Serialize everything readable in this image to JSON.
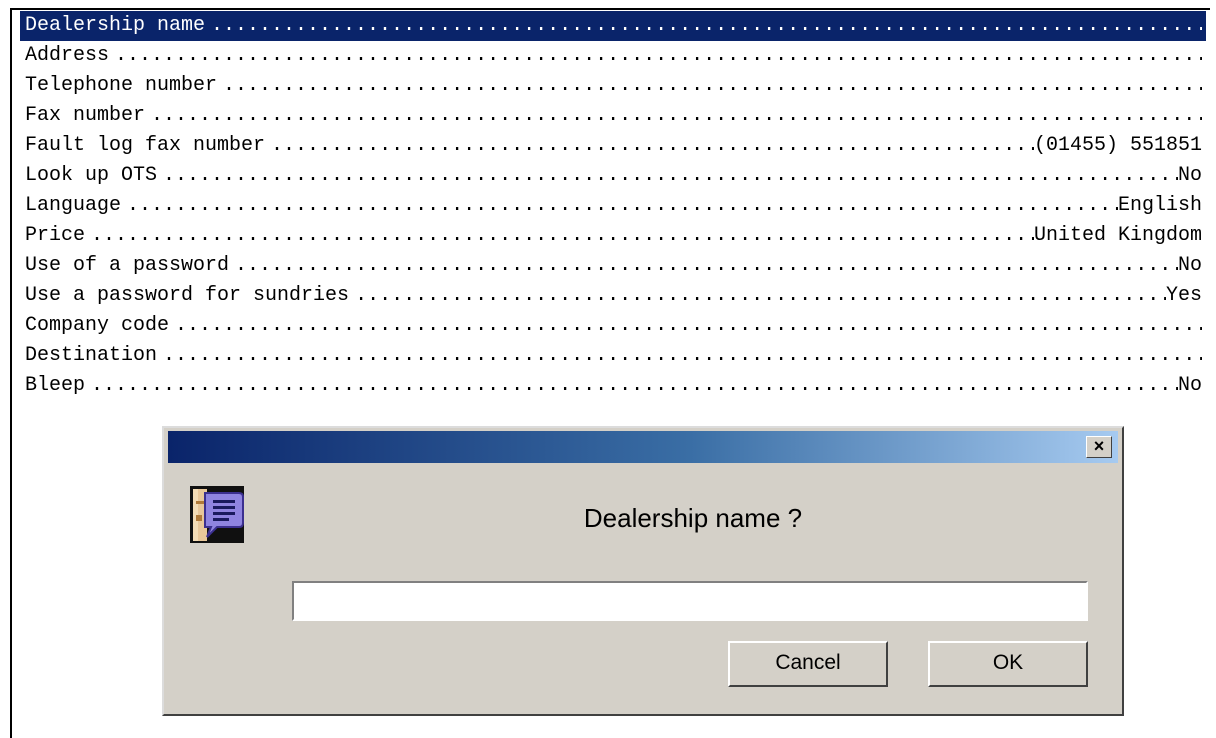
{
  "settings": {
    "rows": [
      {
        "label": "Dealership name",
        "value": "",
        "selected": true
      },
      {
        "label": "Address",
        "value": ""
      },
      {
        "label": "Telephone number",
        "value": ""
      },
      {
        "label": "Fax number",
        "value": ""
      },
      {
        "label": "Fault log fax number",
        "value": "(01455) 551851"
      },
      {
        "label": "Look up OTS",
        "value": "No"
      },
      {
        "label": "Language",
        "value": "English"
      },
      {
        "label": "Price",
        "value": "United Kingdom"
      },
      {
        "label": "Use of a password",
        "value": "No"
      },
      {
        "label": "Use a password for sundries",
        "value": "Yes"
      },
      {
        "label": "Company code",
        "value": ""
      },
      {
        "label": "Destination",
        "value": ""
      },
      {
        "label": "Bleep",
        "value": "No"
      }
    ]
  },
  "dialog": {
    "close_label": "×",
    "icon": "speech-bubble-icon",
    "prompt": "Dealership name ?",
    "input_value": "",
    "cancel_label": "Cancel",
    "ok_label": "OK"
  },
  "colors": {
    "selection": "#0a246a",
    "dialog_bg": "#d4d0c8",
    "title_start": "#0a246a",
    "title_end": "#a6caf0"
  }
}
